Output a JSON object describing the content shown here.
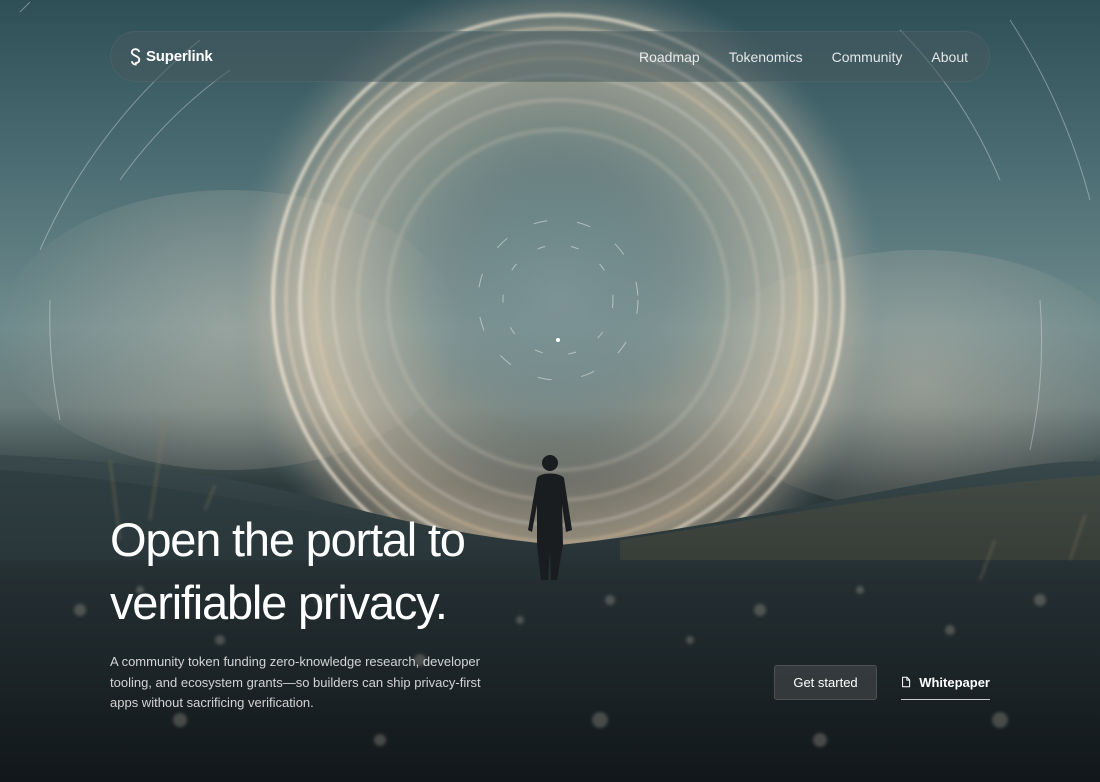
{
  "brand": {
    "name": "Superlink",
    "icon": "s-logo-icon"
  },
  "nav": {
    "items": [
      {
        "label": "Roadmap"
      },
      {
        "label": "Tokenomics"
      },
      {
        "label": "Community"
      },
      {
        "label": "About"
      }
    ]
  },
  "hero": {
    "headline_line1": "Open the portal to",
    "headline_line2": "verifiable privacy.",
    "subcopy": "A community token funding zero-knowledge research, developer tooling, and ecosystem grants—so builders can ship privacy-first apps without sacrificing verification."
  },
  "cta": {
    "primary_label": "Get started",
    "secondary_label": "Whitepaper",
    "secondary_icon": "document-icon"
  },
  "colors": {
    "sky_top": "#2f4f57",
    "sky_horizon": "#6f8b8d",
    "portal_glow": "#f3d9b6",
    "ground": "#151b1d"
  }
}
